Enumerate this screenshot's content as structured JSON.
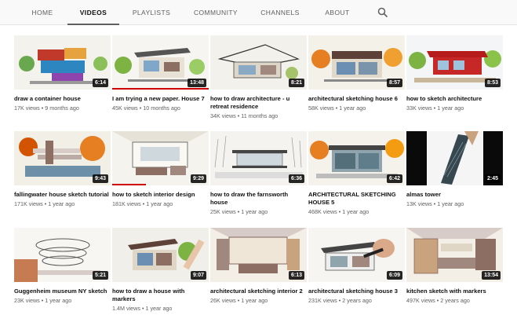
{
  "tabs": [
    {
      "label": "HOME",
      "active": false
    },
    {
      "label": "VIDEOS",
      "active": true
    },
    {
      "label": "PLAYLISTS",
      "active": false
    },
    {
      "label": "COMMUNITY",
      "active": false
    },
    {
      "label": "CHANNELS",
      "active": false
    },
    {
      "label": "ABOUT",
      "active": false
    }
  ],
  "search_icon": "search-icon",
  "videos": [
    {
      "title": "draw a container house",
      "views": "17K views",
      "age": "9 months ago",
      "duration": "6:14"
    },
    {
      "title": "I am trying a new paper. House 7",
      "views": "45K views",
      "age": "10 months ago",
      "duration": "13:48"
    },
    {
      "title": "how to draw architecture - u retreat residence",
      "views": "34K views",
      "age": "11 months ago",
      "duration": "8:21"
    },
    {
      "title": "architectural sketching house 6",
      "views": "58K views",
      "age": "1 year ago",
      "duration": "8:57"
    },
    {
      "title": "how to sketch architecture",
      "views": "33K views",
      "age": "1 year ago",
      "duration": "8:53"
    },
    {
      "title": "fallingwater house sketch tutorial",
      "views": "171K views",
      "age": "1 year ago",
      "duration": "9:43"
    },
    {
      "title": "how to sketch interior design",
      "views": "181K views",
      "age": "1 year ago",
      "duration": "9:29"
    },
    {
      "title": "how to draw the farnsworth house",
      "views": "25K views",
      "age": "1 year ago",
      "duration": "6:36"
    },
    {
      "title": "ARCHITECTURAL SKETCHING HOUSE 5",
      "views": "468K views",
      "age": "1 year ago",
      "duration": "6:42"
    },
    {
      "title": "almas tower",
      "views": "13K views",
      "age": "1 year ago",
      "duration": "2:45"
    },
    {
      "title": "Guggenheim museum NY sketch",
      "views": "23K views",
      "age": "1 year ago",
      "duration": "5:21"
    },
    {
      "title": "how to draw a house with markers",
      "views": "1.4M views",
      "age": "1 year ago",
      "duration": "9:07"
    },
    {
      "title": "architectural sketching interior 2",
      "views": "26K views",
      "age": "1 year ago",
      "duration": "6:13"
    },
    {
      "title": "architectural sketching house 3",
      "views": "231K views",
      "age": "2 years ago",
      "duration": "6:09"
    },
    {
      "title": "kitchen sketch with markers",
      "views": "497K views",
      "age": "2 years ago",
      "duration": "13:54"
    }
  ],
  "watched_progress": [
    0,
    1.0,
    0,
    0,
    0,
    0,
    0.35,
    0,
    0,
    0,
    0,
    0,
    0,
    0,
    0
  ],
  "colors": {
    "progress": "#cc0000",
    "active_tab": "#0f0f0f",
    "meta_text": "#606060"
  }
}
